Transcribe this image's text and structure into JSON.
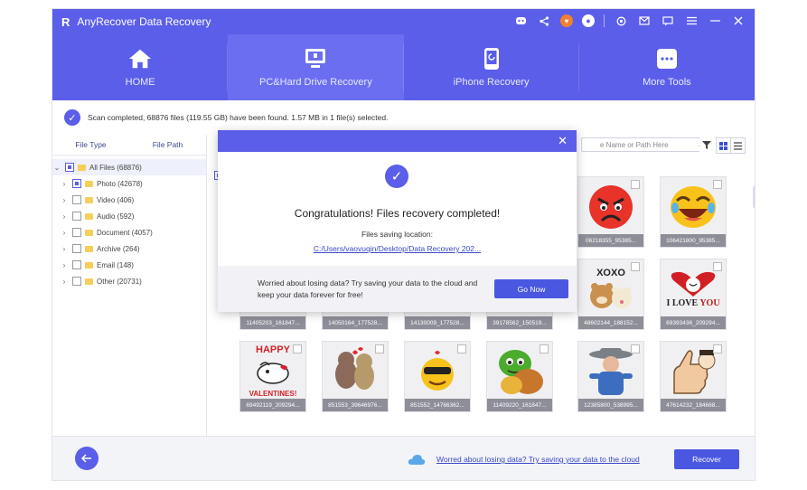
{
  "app": {
    "title": "AnyRecover Data Recovery",
    "logo": "R"
  },
  "titlebar_icons": [
    "discord-icon",
    "share-icon",
    "gift-icon",
    "account-icon",
    "settings-icon",
    "mail-icon",
    "feedback-icon",
    "menu-icon",
    "minimize-icon",
    "close-icon"
  ],
  "nav": [
    {
      "label": "HOME",
      "icon": "home-icon"
    },
    {
      "label": "PC&Hard Drive Recovery",
      "icon": "pc-drive-icon"
    },
    {
      "label": "iPhone Recovery",
      "icon": "iphone-icon"
    },
    {
      "label": "More Tools",
      "icon": "more-tools-icon"
    }
  ],
  "status": {
    "text": "Scan completed, 68876 files (119.55 GB) have been found. 1.57 MB in 1 file(s) selected."
  },
  "left": {
    "tabs": [
      "File Type",
      "File Path"
    ],
    "tree": [
      {
        "label": "All Files (68876)"
      },
      {
        "label": "Photo (42678)"
      },
      {
        "label": "Video (406)"
      },
      {
        "label": "Audio (592)"
      },
      {
        "label": "Document (4057)"
      },
      {
        "label": "Archive (264)"
      },
      {
        "label": "Email (148)"
      },
      {
        "label": "Other (20731)"
      }
    ]
  },
  "search": {
    "placeholder": "e Name or Path Here"
  },
  "thumbs": [
    {
      "caption": "06218355_95385..."
    },
    {
      "caption": "106421800_95385..."
    },
    {
      "caption": "11405203_161847..."
    },
    {
      "caption": "14050164_177528..."
    },
    {
      "caption": "14130009_177528..."
    },
    {
      "caption": "39178562_150519..."
    },
    {
      "caption": "48602144_188152..."
    },
    {
      "caption": "69393436_209294..."
    },
    {
      "caption": "69492119_209294..."
    },
    {
      "caption": "851553_39646976..."
    },
    {
      "caption": "851552_14766362..."
    },
    {
      "caption": "11409220_161847..."
    },
    {
      "caption": "12385800_538995..."
    },
    {
      "caption": "47614232_184668..."
    }
  ],
  "art_text": {
    "xoxo": "XOXO",
    "i_love": "I LOVE",
    "you": "YOU",
    "happy": "HAPPY",
    "valentines": "VALENTINES!"
  },
  "modal": {
    "title": "Congratulations! Files recovery completed!",
    "location_label": "Files saving location:",
    "location_path": "C:/Users/vaovuqin/Desktop/Data Recovery 202...",
    "footer_text": "Worried about losing data? Try saving your data to the cloud and keep your data forever for free!",
    "go_now": "Go Now"
  },
  "bottom": {
    "link": "Worred about losing data? Try saving your data to the cloud",
    "recover": "Recover"
  },
  "colors": {
    "accent": "#5b5ee8",
    "button": "#4a57e0"
  }
}
